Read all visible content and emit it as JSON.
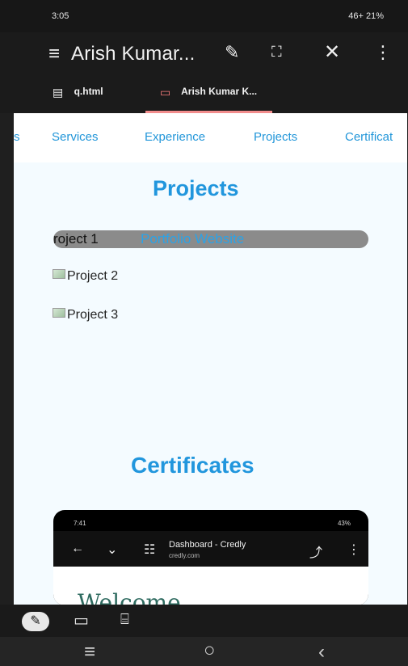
{
  "statusbar": {
    "time": "3:05",
    "right": "46+ 21%"
  },
  "appbar": {
    "menu_icon": "hamburger-icon",
    "title": "Arish Kumar...",
    "edit_icon": "pencil-icon",
    "fullscreen_icon": "fullscreen-icon",
    "close_icon": "close-icon",
    "more_icon": "more-icon"
  },
  "tabs": [
    {
      "label": "q.html",
      "icon": "file-icon"
    },
    {
      "label": "Arish Kumar K...",
      "icon": "browser-icon"
    }
  ],
  "nav": {
    "items": [
      "s",
      "Services",
      "Experience",
      "Projects",
      "Certificat"
    ]
  },
  "projects": {
    "title": "Projects",
    "item1_prefix": "roject 1",
    "item1_name": "Portfolio Website",
    "item2": "Project 2",
    "item3": "Project 3"
  },
  "certificates": {
    "title": "Certificates",
    "preview": {
      "time": "7:41",
      "status": "43%",
      "tab_title": "Dashboard - Credly",
      "domain": "credly.com",
      "welcome": "Welcome"
    }
  },
  "editor": {
    "pencil_icon": "pencil-icon",
    "folder_icon": "folder-icon",
    "terminal_icon": "terminal-icon"
  },
  "navbar": {
    "menu_icon": "recent-apps-icon",
    "home_icon": "home-icon",
    "back_icon": "back-icon"
  }
}
